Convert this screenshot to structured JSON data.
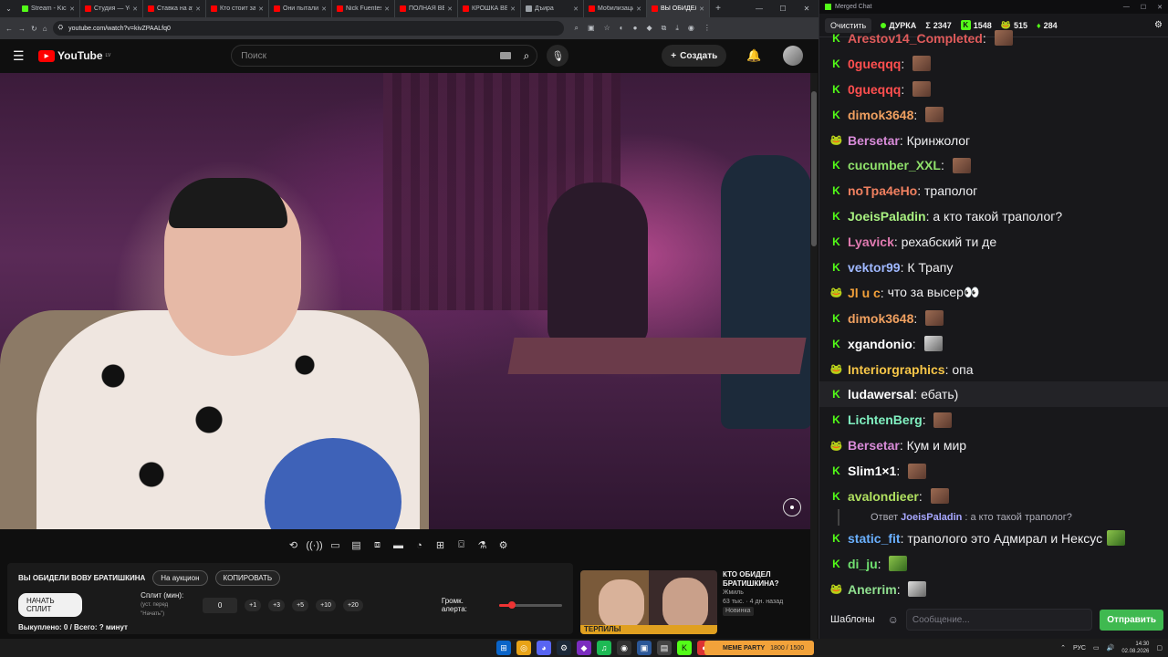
{
  "browser": {
    "tabs": [
      {
        "label": "Stream - Kick",
        "color": "#53fc18"
      },
      {
        "label": "Студия — YouTube",
        "color": "#ff0000"
      },
      {
        "label": "Ставка на аукцион",
        "color": "#ff0000"
      },
      {
        "label": "Кто стоит за",
        "color": "#ff0000"
      },
      {
        "label": "Они пытались",
        "color": "#ff0000"
      },
      {
        "label": "Nick Fuentes",
        "color": "#ff0000"
      },
      {
        "label": "ПОЛНАЯ ВЕРСИЯ",
        "color": "#ff0000"
      },
      {
        "label": "КРОШКА ВЕС",
        "color": "#ff0000"
      },
      {
        "label": "Дъира",
        "color": "#9aa0a6"
      },
      {
        "label": "Мобилизация",
        "color": "#ff0000"
      },
      {
        "label": "ВЫ ОБИДЕЛИ",
        "color": "#ff0000",
        "active": true
      }
    ],
    "url": "youtube.com/watch?v=kivZPAALfq0"
  },
  "youtube": {
    "logo_text": "YouTube",
    "region": "LV",
    "search_placeholder": "Поиск",
    "create_label": "Создать"
  },
  "auction_panel": {
    "title": "ВЫ ОБИДЕЛИ ВОВУ БРАТИШКИНА",
    "auction_btn": "На аукцион",
    "copy_btn": "КОПИРОВАТЬ",
    "start_split_btn": "НАЧАТЬ СПЛИТ",
    "split_label": "Сплит (мин):",
    "split_hint": "(уст. перед \"Начать\")",
    "split_value": "0",
    "increments": [
      "+1",
      "+3",
      "+5",
      "+10",
      "+20"
    ],
    "alert_volume_label": "Громк. алерта:",
    "alert_volume_fraction": 0.2,
    "footer": "Выкуплено: 0 / Всего: ? минут"
  },
  "recommendation": {
    "thumb_caption": "ТЕРПИЛЫ",
    "title_line1": "КТО ОБИДЕЛ",
    "title_line2": "БРАТИШКИНА?",
    "channel": "Жмиль",
    "meta": "63 тыс. · 4 дн. назад",
    "badge": "Новинка"
  },
  "chat": {
    "window_title": "Merged Chat",
    "clear_btn": "Очистить",
    "channel_name": "ДУРКА",
    "stat_total": "2347",
    "stat_kick": "1548",
    "stat_yt": "515",
    "stat_other": "284",
    "messages": [
      {
        "platform": "kick",
        "name": "Arestov14_Completed",
        "color": "#e05b5b",
        "text": "",
        "emote": "pic"
      },
      {
        "platform": "kick",
        "name": "0gueqqq",
        "color": "#ff4f4f",
        "text": "",
        "emote": "pic"
      },
      {
        "platform": "kick",
        "name": "0gueqqq",
        "color": "#ff4f4f",
        "text": "",
        "emote": "pic"
      },
      {
        "platform": "kick",
        "name": "dimok3648",
        "color": "#f0a060",
        "text": "",
        "emote": "pic"
      },
      {
        "platform": "yt",
        "name": "Bersetar",
        "color": "#d88bd8",
        "text": "Кринжолог",
        "emote": ""
      },
      {
        "platform": "kick",
        "name": "cucumber_XXL",
        "color": "#8fe06b",
        "text": "",
        "emote": "pic"
      },
      {
        "platform": "kick",
        "name": "noTpa4eHo",
        "color": "#f08060",
        "text": "траполог",
        "emote": ""
      },
      {
        "platform": "kick",
        "name": "JoeisPaladin",
        "color": "#a8f080",
        "text": "а кто такой траполог?",
        "emote": ""
      },
      {
        "platform": "kick",
        "name": "Lyavick",
        "color": "#e07ab0",
        "text": "рехабский ти де",
        "emote": ""
      },
      {
        "platform": "kick",
        "name": "vektor99",
        "color": "#9fb8ff",
        "text": "К Трапу",
        "emote": ""
      },
      {
        "platform": "yt",
        "name": "Jl u c",
        "color": "#f2a03a",
        "text": "что за высер👀",
        "emote": ""
      },
      {
        "platform": "kick",
        "name": "dimok3648",
        "color": "#f0a060",
        "text": "",
        "emote": "pic"
      },
      {
        "platform": "kick",
        "name": "xgandonio",
        "color": "#ffffff",
        "text": "",
        "emote": "cat"
      },
      {
        "platform": "yt",
        "name": "Interiorgraphics",
        "color": "#f7c648",
        "text": "опа",
        "emote": ""
      },
      {
        "platform": "kick",
        "name": "ludawersal",
        "color": "#ffffff",
        "text": "ебать)",
        "emote": "",
        "highlight": true
      },
      {
        "platform": "kick",
        "name": "LichtenBerg",
        "color": "#80f0c0",
        "text": "",
        "emote": "pic"
      },
      {
        "platform": "yt",
        "name": "Bersetar",
        "color": "#d88bd8",
        "text": "Кум и мир",
        "emote": ""
      },
      {
        "platform": "kick",
        "name": "Slim1×1",
        "color": "#ffffff",
        "text": "",
        "emote": "pic"
      },
      {
        "platform": "kick",
        "name": "avalondieer",
        "color": "#b0e060",
        "text": "",
        "emote": "pic"
      }
    ],
    "reply": {
      "prefix": "Ответ",
      "to": "JoeisPaladin",
      "text": "а кто такой траполог?"
    },
    "messages_after": [
      {
        "platform": "kick",
        "name": "static_fit",
        "color": "#6ab0ff",
        "text": "траполого это Адмирал и Нексус",
        "emote": "frog"
      },
      {
        "platform": "kick",
        "name": "di_ju",
        "color": "#70e070",
        "text": "",
        "emote": "frog"
      },
      {
        "platform": "yt",
        "name": "Anerrim",
        "color": "#90e090",
        "text": "",
        "emote": "cat"
      }
    ],
    "templates_btn": "Шаблоны",
    "input_placeholder": "Сообщение...",
    "send_btn": "Отправить"
  },
  "taskbar": {
    "kick_widget": "MEME PARTY",
    "kick_widget_sub": "1800 / 1500",
    "lang": "РУС",
    "time": "14:30",
    "date": "02.08.2026"
  }
}
